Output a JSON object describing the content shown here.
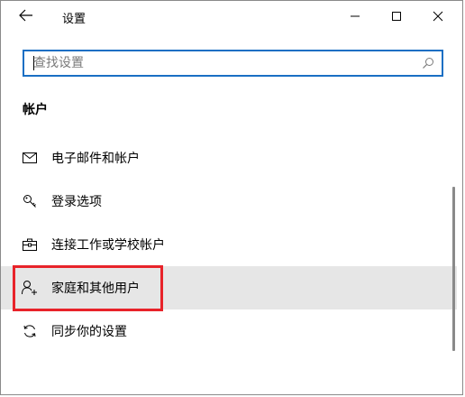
{
  "window": {
    "title": "设置"
  },
  "search": {
    "placeholder": "查找设置",
    "value": ""
  },
  "section": {
    "title": "帐户"
  },
  "nav": {
    "items": [
      {
        "icon": "mail-icon",
        "label": "电子邮件和帐户",
        "selected": false
      },
      {
        "icon": "key-icon",
        "label": "登录选项",
        "selected": false
      },
      {
        "icon": "briefcase-icon",
        "label": "连接工作或学校帐户",
        "selected": false
      },
      {
        "icon": "person-add-icon",
        "label": "家庭和其他用户",
        "selected": true
      },
      {
        "icon": "sync-icon",
        "label": "同步你的设置",
        "selected": false
      }
    ]
  },
  "colors": {
    "accent": "#1a6fc4",
    "highlight_box": "#e8232a",
    "selected_row": "#e6e6e6"
  }
}
